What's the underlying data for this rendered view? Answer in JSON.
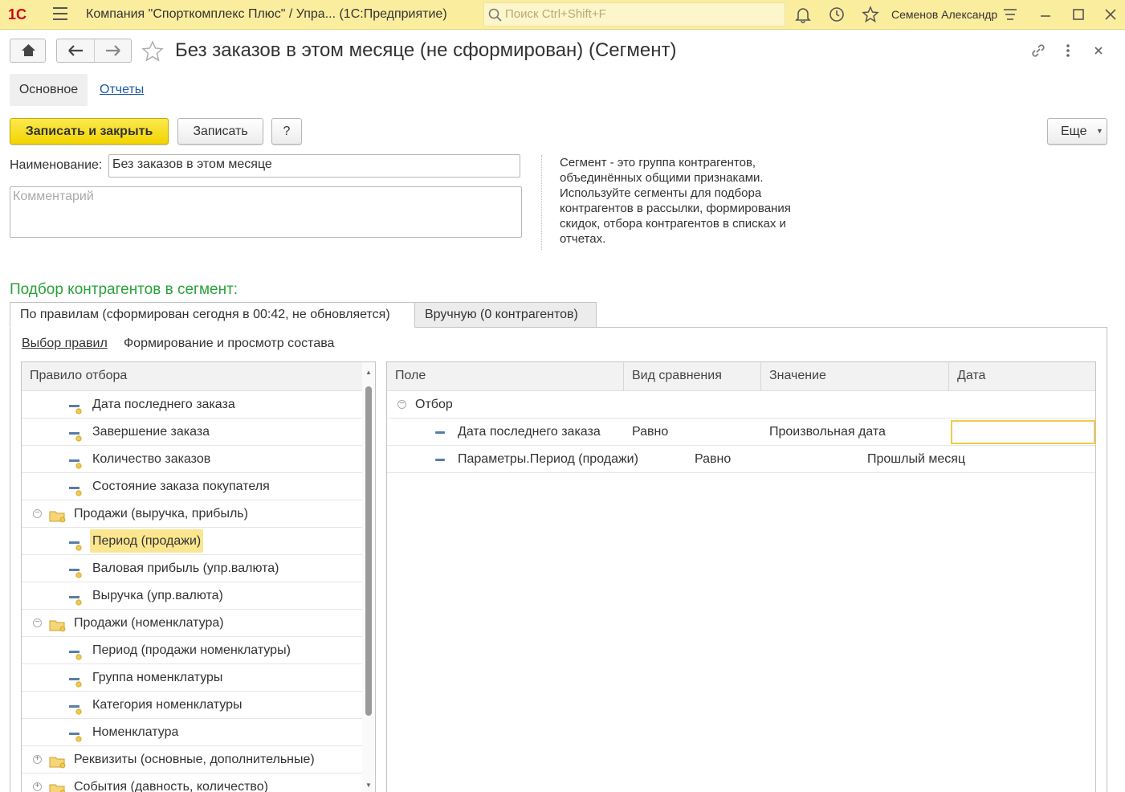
{
  "topbar": {
    "logo": "1С",
    "title": "Компания \"Спорткомплекс Плюс\" / Упра...  (1С:Предприятие)",
    "search_placeholder": "Поиск Ctrl+Shift+F",
    "user": "Семенов Александр"
  },
  "header": {
    "title": "Без заказов в этом месяце (не сформирован) (Сегмент)"
  },
  "form_tabs": {
    "main": "Основное",
    "reports": "Отчеты"
  },
  "toolbar": {
    "save_close": "Записать и закрыть",
    "save": "Записать",
    "help": "?",
    "more": "Еще"
  },
  "fields": {
    "name_label": "Наименование:",
    "name_value": "Без заказов в этом месяце",
    "comment_placeholder": "Комментарий"
  },
  "description": "Сегмент - это группа контрагентов, объединённых общими признаками. Используйте сегменты для подбора контрагентов в рассылки, формирования скидок, отбора контрагентов в списках и отчетах.",
  "section_title": "Подбор контрагентов в сегмент:",
  "tabs": {
    "by_rules": "По правилам (сформирован сегодня в 00:42, не обновляется)",
    "manual": "Вручную (0 контрагентов)"
  },
  "subtabs": {
    "rules": "Выбор правил",
    "formation": "Формирование и просмотр состава"
  },
  "tree": {
    "header": "Правило отбора",
    "rows": [
      {
        "label": "Дата последнего заказа",
        "kind": "field"
      },
      {
        "label": "Завершение заказа",
        "kind": "field"
      },
      {
        "label": "Количество заказов",
        "kind": "field"
      },
      {
        "label": "Состояние заказа покупателя",
        "kind": "field"
      },
      {
        "label": "Продажи (выручка, прибыль)",
        "kind": "folder",
        "exp": "minus"
      },
      {
        "label": "Период (продажи)",
        "kind": "field",
        "selected": true
      },
      {
        "label": "Валовая прибыль (упр.валюта)",
        "kind": "field"
      },
      {
        "label": "Выручка (упр.валюта)",
        "kind": "field"
      },
      {
        "label": "Продажи (номенклатура)",
        "kind": "folder",
        "exp": "minus"
      },
      {
        "label": "Период (продажи номенклатуры)",
        "kind": "field"
      },
      {
        "label": "Группа номенклатуры",
        "kind": "field"
      },
      {
        "label": "Категория номенклатуры",
        "kind": "field"
      },
      {
        "label": "Номенклатура",
        "kind": "field"
      },
      {
        "label": "Реквизиты (основные, дополнительные)",
        "kind": "folder",
        "exp": "plus"
      },
      {
        "label": "События (давность, количество)",
        "kind": "folder",
        "exp": "plus"
      }
    ]
  },
  "grid": {
    "columns": [
      "Поле",
      "Вид сравнения",
      "Значение",
      "Дата"
    ],
    "group": "Отбор",
    "rows": [
      {
        "field": "Дата последнего заказа",
        "comparison": "Равно",
        "value": "Произвольная дата",
        "date": ""
      },
      {
        "field": "Параметры.Период (продажи)",
        "comparison": "Равно",
        "value": "Прошлый месяц",
        "date": ""
      }
    ]
  },
  "colors": {
    "accent": "#fbed9e",
    "primary_button": "#f2d400",
    "section_title": "#2ba13b",
    "link": "#1e59a8",
    "selection": "#fbe58f"
  }
}
